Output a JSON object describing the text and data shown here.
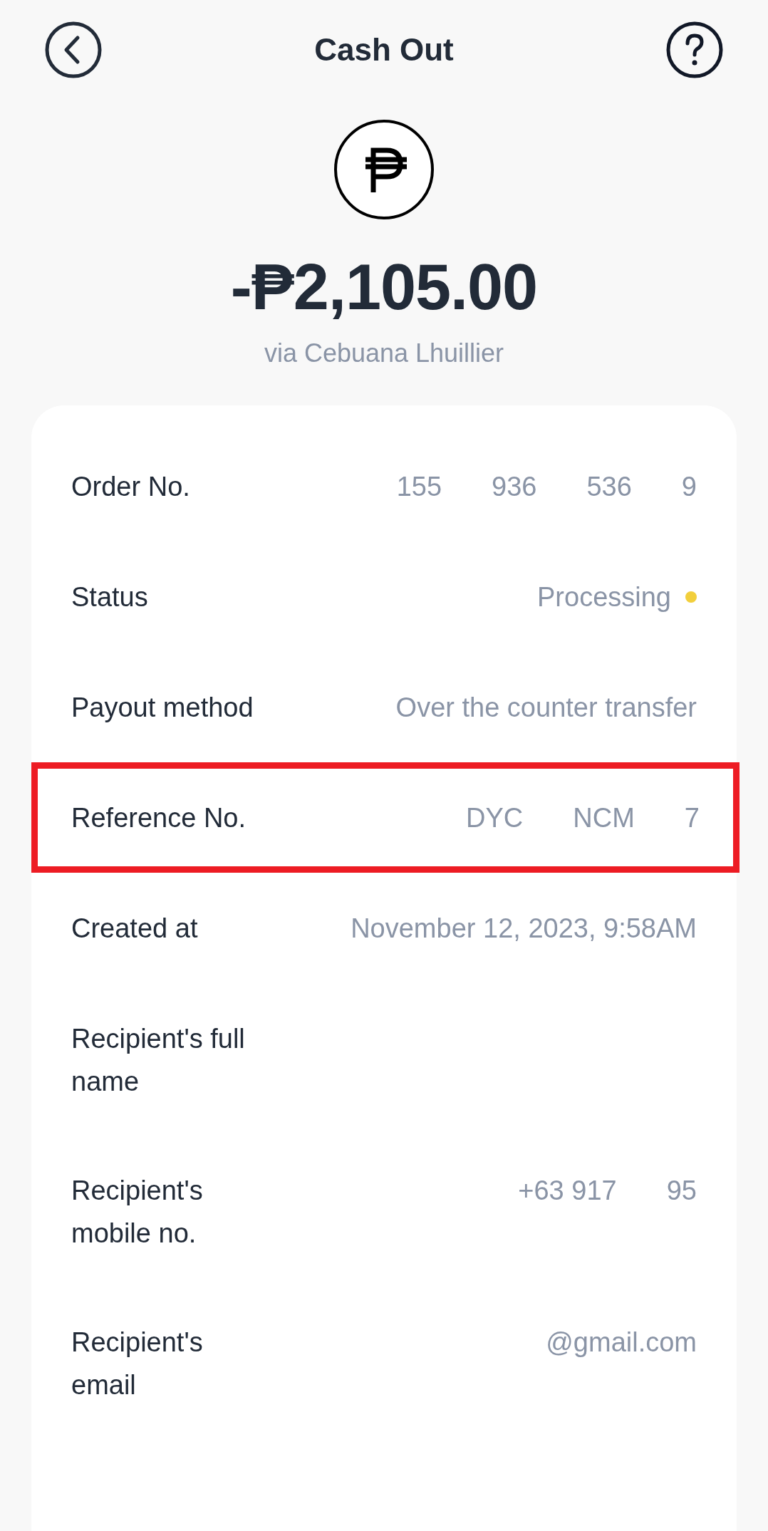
{
  "header": {
    "title": "Cash Out"
  },
  "amount": "-₱2,105.00",
  "via": "via Cebuana Lhuillier",
  "rows": [
    {
      "kind": "text",
      "label": "Order No.",
      "value_parts": [
        "155",
        "936",
        "536",
        "9"
      ],
      "highlighted": false
    },
    {
      "kind": "status",
      "label": "Status",
      "value_parts": [
        "Processing"
      ],
      "color": "#f2cf3c",
      "highlighted": false
    },
    {
      "kind": "text",
      "label": "Payout method",
      "value_parts": [
        "Over the counter transfer"
      ],
      "highlighted": false
    },
    {
      "kind": "text",
      "label": "Reference No.",
      "value_parts": [
        "DYC",
        "NCM",
        "7"
      ],
      "highlighted": true
    },
    {
      "kind": "text",
      "label": "Created at",
      "value_parts": [
        "November 12, 2023, 9:58AM"
      ],
      "highlighted": false
    },
    {
      "kind": "text",
      "label": "Recipient's full name",
      "value_parts": [],
      "highlighted": false
    },
    {
      "kind": "text",
      "label": "Recipient's mobile no.",
      "value_parts": [
        "+63 917",
        "95"
      ],
      "highlighted": false
    },
    {
      "kind": "text",
      "label": "Recipient's email",
      "value_parts": [
        "@gmail.com"
      ],
      "highlighted": false
    }
  ]
}
